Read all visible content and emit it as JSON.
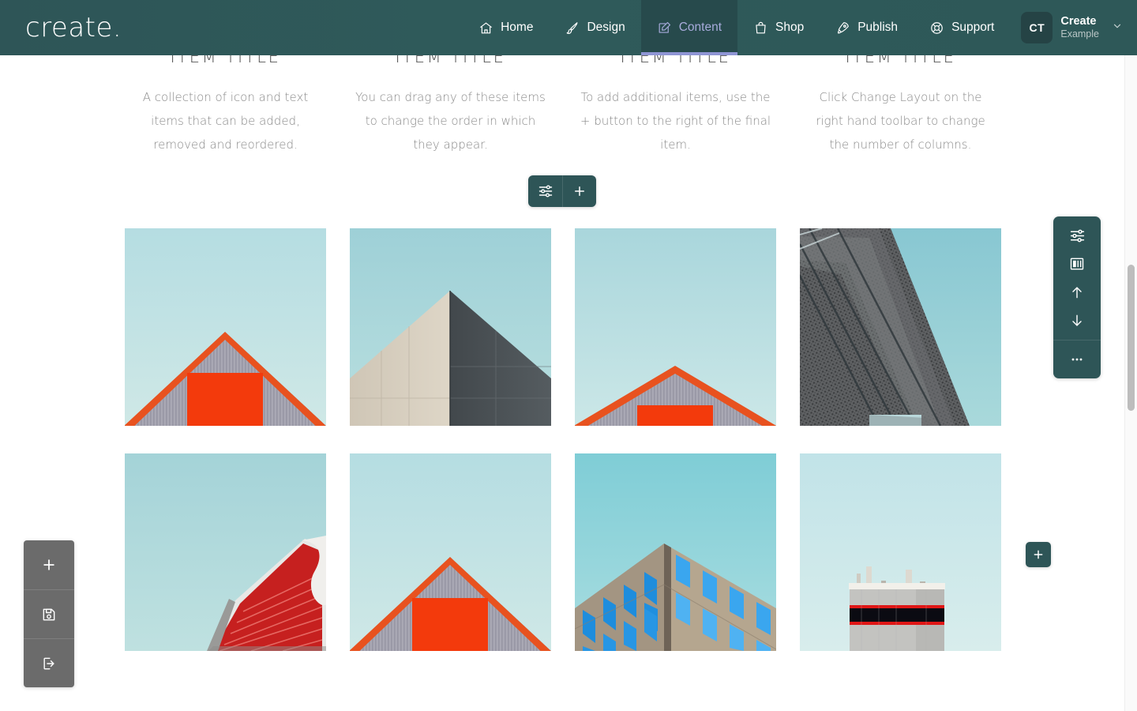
{
  "app": {
    "logo": "create.",
    "accent_dark": "#2e5557",
    "accent_active_text": "#a7abdb",
    "toolbar_grey": "#6b6b6b"
  },
  "nav": {
    "items": [
      {
        "label": "Home",
        "icon": "home-icon",
        "active": false
      },
      {
        "label": "Design",
        "icon": "brush-icon",
        "active": false
      },
      {
        "label": "Content",
        "icon": "edit-icon",
        "active": true
      },
      {
        "label": "Shop",
        "icon": "bag-icon",
        "active": false
      },
      {
        "label": "Publish",
        "icon": "rocket-icon",
        "active": false
      },
      {
        "label": "Support",
        "icon": "lifering-icon",
        "active": false
      }
    ]
  },
  "account": {
    "initials": "CT",
    "name": "Create",
    "subtitle": "Example",
    "chevron": "chevron-down-icon"
  },
  "content": {
    "columns": [
      {
        "title": "ITEM TITLE",
        "body": "A collection of icon and text items that can be added, removed and reordered."
      },
      {
        "title": "ITEM TITLE",
        "body": "You can drag any of these items to change the order in which they appear."
      },
      {
        "title": "ITEM TITLE",
        "body": "To add additional items, use the + button to the right of the final item."
      },
      {
        "title": "ITEM TITLE",
        "body": "Click Change Layout on the right hand toolbar to change the number of columns."
      }
    ],
    "images": [
      {
        "alt": "Grey corrugated gable roof with orange trim and red square against pale blue sky"
      },
      {
        "alt": "Concrete building corner, light beige and dark charcoal faces against teal sky"
      },
      {
        "alt": "Grey corrugated gable roof with orange trim, roof low in frame, teal sky"
      },
      {
        "alt": "Dark perforated brick facade seen from below against teal sky"
      },
      {
        "alt": "Red slatted canopy with white curved frame against teal sky"
      },
      {
        "alt": "Grey corrugated gable roof with orange trim and red square against pale blue sky"
      },
      {
        "alt": "Sandstone building corner with blue glass windows against teal sky"
      },
      {
        "alt": "Grey industrial block with red-edged black stripe and roof pipes against teal sky"
      }
    ]
  },
  "item_toolbar": {
    "buttons": [
      {
        "name": "settings-sliders-icon",
        "label": "Settings"
      },
      {
        "name": "plus-icon",
        "label": "Add"
      }
    ]
  },
  "right_toolbar": {
    "buttons": [
      {
        "name": "settings-sliders-icon",
        "label": "Settings"
      },
      {
        "name": "columns-layout-icon",
        "label": "Change Layout"
      },
      {
        "name": "arrow-up-icon",
        "label": "Move Up"
      },
      {
        "name": "arrow-down-icon",
        "label": "Move Down"
      },
      {
        "name": "more-options-icon",
        "label": "More"
      }
    ]
  },
  "left_toolbar": {
    "buttons": [
      {
        "name": "plus-icon",
        "label": "Add"
      },
      {
        "name": "save-icon",
        "label": "Save"
      },
      {
        "name": "exit-icon",
        "label": "Exit"
      }
    ]
  },
  "add_section": {
    "label": "+"
  }
}
